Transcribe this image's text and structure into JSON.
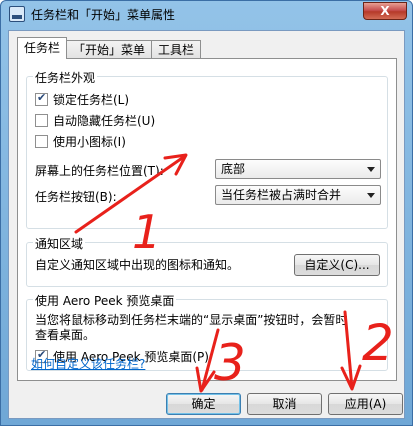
{
  "window": {
    "title": "任务栏和「开始」菜单属性",
    "close_glyph": "X"
  },
  "tabs": [
    {
      "label": "任务栏"
    },
    {
      "label": "「开始」菜单"
    },
    {
      "label": "工具栏"
    }
  ],
  "appearance": {
    "heading": "任务栏外观",
    "lock_taskbar": {
      "label": "锁定任务栏(L)",
      "checked": true
    },
    "auto_hide": {
      "label": "自动隐藏任务栏(U)",
      "checked": false
    },
    "small_icons": {
      "label": "使用小图标(I)",
      "checked": false
    },
    "location_label": "屏幕上的任务栏位置(T):",
    "location_value": "底部",
    "buttons_label": "任务栏按钮(B):",
    "buttons_value": "当任务栏被占满时合并"
  },
  "notification": {
    "heading": "通知区域",
    "text": "自定义通知区域中出现的图标和通知。",
    "customize_button": "自定义(C)..."
  },
  "aero_peek": {
    "heading": "使用 Aero Peek 预览桌面",
    "description_line1": "当您将鼠标移动到任务栏末端的“显示桌面”按钮时，会暂时",
    "description_line2": "查看桌面。",
    "checkbox": {
      "label": "使用 Aero Peek 预览桌面(P)",
      "checked": true
    }
  },
  "help_link": "如何自定义该任务栏?",
  "buttons": {
    "ok": "确定",
    "cancel": "取消",
    "apply": "应用(A)"
  },
  "annotations": {
    "color": "#e8211b",
    "labels": [
      "1",
      "2",
      "3"
    ]
  }
}
